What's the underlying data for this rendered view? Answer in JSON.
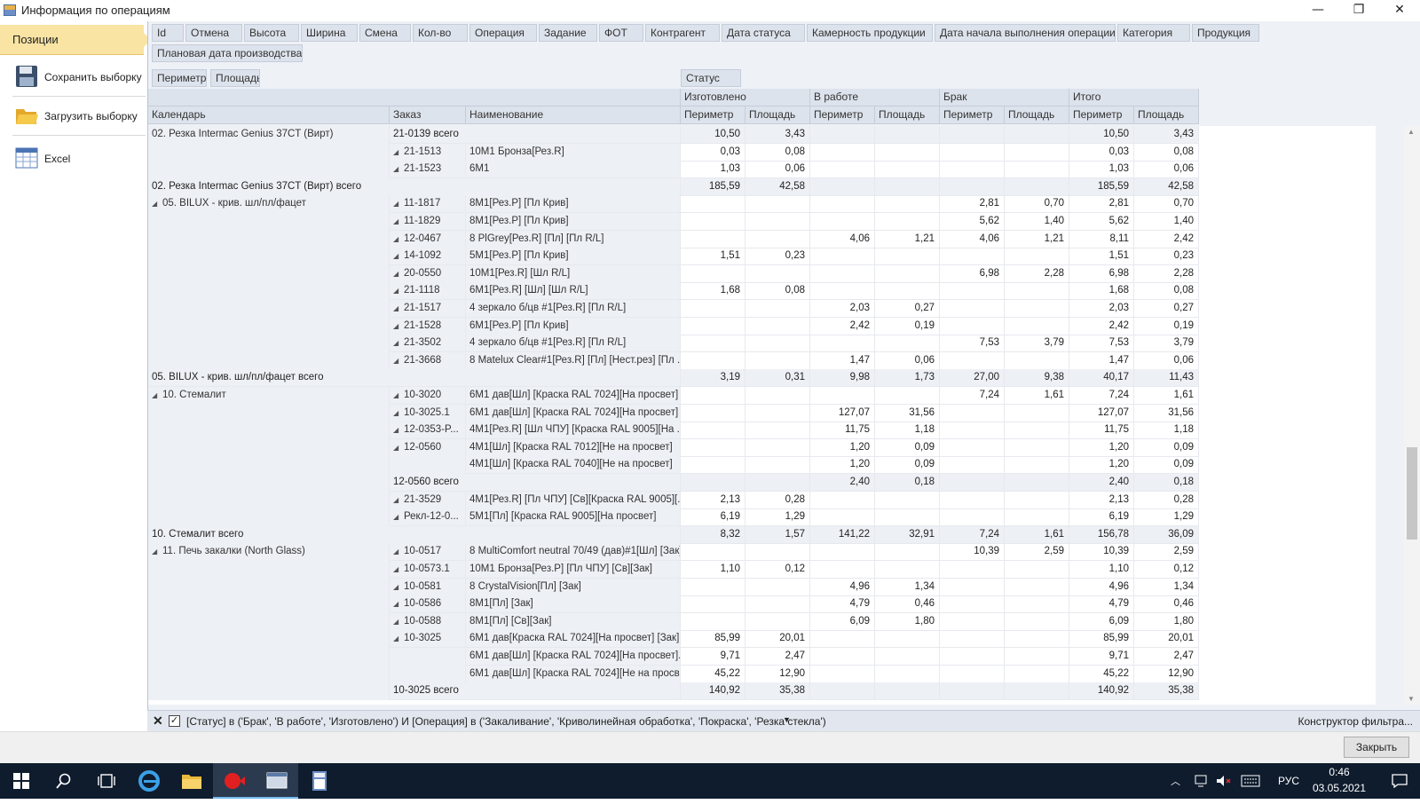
{
  "window": {
    "title": "Информация по операциям",
    "minimize": "—",
    "restore": "❐",
    "close": "✕"
  },
  "left_panel": {
    "tab_label": "Позиции",
    "items": [
      {
        "label": "Сохранить выборку",
        "icon": "save-icon"
      },
      {
        "label": "Загрузить выборку",
        "icon": "folder-open-icon"
      },
      {
        "label": "Excel",
        "icon": "excel-icon"
      }
    ]
  },
  "field_buttons": [
    "Id",
    "Отмена",
    "Высота",
    "Ширина",
    "Смена",
    "Кол-во",
    "Операция",
    "Задание",
    "ФОТ",
    "Контрагент",
    "Дата статуса",
    "Камерность продукции",
    "Дата начала выполнения операции",
    "Категория",
    "Продукция",
    "Плановая дата производства"
  ],
  "data_buttons": [
    "Периметр",
    "Площадь"
  ],
  "column_field_button": "Статус",
  "row_headers": [
    "Календарь",
    "Заказ",
    "Наименование"
  ],
  "status_groups": [
    "Изготовлено",
    "В работе",
    "Брак",
    "Итого"
  ],
  "measure_headers": [
    "Периметр",
    "Площадь"
  ],
  "rows": [
    {
      "cal": "02. Резка Intermac Genius 37CT (Вирт)",
      "order": "21-0139 всего",
      "orderTotal": true,
      "name": "",
      "v": [
        "10,50",
        "3,43",
        "",
        "",
        "",
        "",
        "10,50",
        "3,43"
      ]
    },
    {
      "cal": "",
      "order": "21-1513",
      "name": "10M1 Бронза[Рез.R]",
      "v": [
        "0,03",
        "0,08",
        "",
        "",
        "",
        "",
        "0,03",
        "0,08"
      ]
    },
    {
      "cal": "",
      "order": "21-1523",
      "name": "6M1",
      "v": [
        "1,03",
        "0,06",
        "",
        "",
        "",
        "",
        "1,03",
        "0,06"
      ]
    },
    {
      "cal": "02. Резка Intermac Genius 37CT (Вирт) всего",
      "calTotal": true,
      "v": [
        "185,59",
        "42,58",
        "",
        "",
        "",
        "",
        "185,59",
        "42,58"
      ]
    },
    {
      "cal": "05. BILUX - крив. шл/пл/фацет",
      "calExp": true,
      "order": "11-1817",
      "name": "8M1[Рез.Р] [Пл Крив]",
      "v": [
        "",
        "",
        "",
        "",
        "2,81",
        "0,70",
        "2,81",
        "0,70"
      ]
    },
    {
      "cal": "",
      "order": "11-1829",
      "name": "8M1[Рез.Р] [Пл Крив]",
      "v": [
        "",
        "",
        "",
        "",
        "5,62",
        "1,40",
        "5,62",
        "1,40"
      ]
    },
    {
      "cal": "",
      "order": "12-0467",
      "name": "8 PlGrey[Рез.R] [Пл] [Пл R/L]",
      "v": [
        "",
        "",
        "4,06",
        "1,21",
        "4,06",
        "1,21",
        "8,11",
        "2,42"
      ]
    },
    {
      "cal": "",
      "order": "14-1092",
      "name": "5M1[Рез.Р] [Пл Крив]",
      "v": [
        "1,51",
        "0,23",
        "",
        "",
        "",
        "",
        "1,51",
        "0,23"
      ]
    },
    {
      "cal": "",
      "order": "20-0550",
      "name": "10M1[Рез.R] [Шл R/L]",
      "v": [
        "",
        "",
        "",
        "",
        "6,98",
        "2,28",
        "6,98",
        "2,28"
      ]
    },
    {
      "cal": "",
      "order": "21-1118",
      "name": "6M1[Рез.R] [Шл] [Шл R/L]",
      "v": [
        "1,68",
        "0,08",
        "",
        "",
        "",
        "",
        "1,68",
        "0,08"
      ]
    },
    {
      "cal": "",
      "order": "21-1517",
      "name": "4 зеркало б/цв #1[Рез.R] [Пл R/L]",
      "v": [
        "",
        "",
        "2,03",
        "0,27",
        "",
        "",
        "2,03",
        "0,27"
      ]
    },
    {
      "cal": "",
      "order": "21-1528",
      "name": "6M1[Рез.Р] [Пл Крив]",
      "v": [
        "",
        "",
        "2,42",
        "0,19",
        "",
        "",
        "2,42",
        "0,19"
      ]
    },
    {
      "cal": "",
      "order": "21-3502",
      "name": "4 зеркало б/цв #1[Рез.R] [Пл R/L]",
      "v": [
        "",
        "",
        "",
        "",
        "7,53",
        "3,79",
        "7,53",
        "3,79"
      ]
    },
    {
      "cal": "",
      "order": "21-3668",
      "name": "8 Matelux Clear#1[Рез.R] [Пл] [Нест.рез] [Пл ...",
      "v": [
        "",
        "",
        "1,47",
        "0,06",
        "",
        "",
        "1,47",
        "0,06"
      ]
    },
    {
      "cal": "05. BILUX - крив. шл/пл/фацет всего",
      "calTotal": true,
      "v": [
        "3,19",
        "0,31",
        "9,98",
        "1,73",
        "27,00",
        "9,38",
        "40,17",
        "11,43"
      ]
    },
    {
      "cal": "10. Стемалит",
      "calExp": true,
      "order": "10-3020",
      "name": "6M1 дав[Шл] [Краска RAL 7024][На просвет]",
      "v": [
        "",
        "",
        "",
        "",
        "7,24",
        "1,61",
        "7,24",
        "1,61"
      ]
    },
    {
      "cal": "",
      "order": "10-3025.1",
      "name": "6M1 дав[Шл] [Краска RAL 7024][На просвет]",
      "v": [
        "",
        "",
        "127,07",
        "31,56",
        "",
        "",
        "127,07",
        "31,56"
      ]
    },
    {
      "cal": "",
      "order": "12-0353-P...",
      "name": "4M1[Рез.R] [Шл ЧПУ] [Краска RAL 9005][На ...",
      "v": [
        "",
        "",
        "11,75",
        "1,18",
        "",
        "",
        "11,75",
        "1,18"
      ]
    },
    {
      "cal": "",
      "order": "12-0560",
      "name": "4M1[Шл] [Краска RAL 7012][Не на просвет]",
      "v": [
        "",
        "",
        "1,20",
        "0,09",
        "",
        "",
        "1,20",
        "0,09"
      ]
    },
    {
      "cal": "",
      "order": "",
      "contName": true,
      "name": "4M1[Шл] [Краска RAL 7040][Не на просвет]",
      "v": [
        "",
        "",
        "1,20",
        "0,09",
        "",
        "",
        "1,20",
        "0,09"
      ]
    },
    {
      "cal": "",
      "order": "12-0560 всего",
      "orderTotal": true,
      "name": "",
      "v": [
        "",
        "",
        "2,40",
        "0,18",
        "",
        "",
        "2,40",
        "0,18"
      ]
    },
    {
      "cal": "",
      "order": "21-3529",
      "name": "4M1[Рез.R] [Пл ЧПУ] [Св][Краска RAL 9005][...",
      "v": [
        "2,13",
        "0,28",
        "",
        "",
        "",
        "",
        "2,13",
        "0,28"
      ]
    },
    {
      "cal": "",
      "order": "Рекл-12-0...",
      "name": "5M1[Пл] [Краска RAL 9005][На просвет]",
      "v": [
        "6,19",
        "1,29",
        "",
        "",
        "",
        "",
        "6,19",
        "1,29"
      ]
    },
    {
      "cal": "10. Стемалит всего",
      "calTotal": true,
      "v": [
        "8,32",
        "1,57",
        "141,22",
        "32,91",
        "7,24",
        "1,61",
        "156,78",
        "36,09"
      ]
    },
    {
      "cal": "11. Печь закалки (North Glass)",
      "calExp": true,
      "order": "10-0517",
      "name": "8 MultiComfort neutral  70/49 (дав)#1[Шл] [Зак]",
      "v": [
        "",
        "",
        "",
        "",
        "10,39",
        "2,59",
        "10,39",
        "2,59"
      ]
    },
    {
      "cal": "",
      "order": "10-0573.1",
      "name": "10M1 Бронза[Рез.Р] [Пл ЧПУ] [Св][Зак]",
      "v": [
        "1,10",
        "0,12",
        "",
        "",
        "",
        "",
        "1,10",
        "0,12"
      ]
    },
    {
      "cal": "",
      "order": "10-0581",
      "name": "8 CrystalVision[Пл] [Зак]",
      "v": [
        "",
        "",
        "4,96",
        "1,34",
        "",
        "",
        "4,96",
        "1,34"
      ]
    },
    {
      "cal": "",
      "order": "10-0586",
      "name": "8M1[Пл] [Зак]",
      "v": [
        "",
        "",
        "4,79",
        "0,46",
        "",
        "",
        "4,79",
        "0,46"
      ]
    },
    {
      "cal": "",
      "order": "10-0588",
      "name": "8M1[Пл] [Св][Зак]",
      "v": [
        "",
        "",
        "6,09",
        "1,80",
        "",
        "",
        "6,09",
        "1,80"
      ]
    },
    {
      "cal": "",
      "order": "10-3025",
      "name": "6M1 дав[Краска RAL 7024][На просвет] [Зак]",
      "v": [
        "85,99",
        "20,01",
        "",
        "",
        "",
        "",
        "85,99",
        "20,01"
      ]
    },
    {
      "cal": "",
      "order": "",
      "contName": true,
      "name": "6M1 дав[Шл] [Краска RAL 7024][На просвет]...",
      "v": [
        "9,71",
        "2,47",
        "",
        "",
        "",
        "",
        "9,71",
        "2,47"
      ]
    },
    {
      "cal": "",
      "order": "",
      "contName": true,
      "name": "6M1 дав[Шл] [Краска RAL 7024][Не на просв...",
      "v": [
        "45,22",
        "12,90",
        "",
        "",
        "",
        "",
        "45,22",
        "12,90"
      ]
    },
    {
      "cal": "",
      "order": "10-3025 всего",
      "orderTotal": true,
      "name": "",
      "v": [
        "140,92",
        "35,38",
        "",
        "",
        "",
        "",
        "140,92",
        "35,38"
      ]
    }
  ],
  "filter_bar": {
    "text": "[Статус] в ('Брак', 'В работе', 'Изготовлено') И [Операция] в ('Закаливание', 'Криволинейная обработка', 'Покраска', 'Резка стекла')",
    "constructor_label": "Конструктор фильтра..."
  },
  "close_button": "Закрыть",
  "taskbar": {
    "lang": "РУС",
    "time": "0:46",
    "date": "03.05.2021"
  },
  "colors": {
    "accent_tab": "#f9e4a4",
    "grid_header": "#dde3ec",
    "taskbar": "#0f1c2e"
  }
}
